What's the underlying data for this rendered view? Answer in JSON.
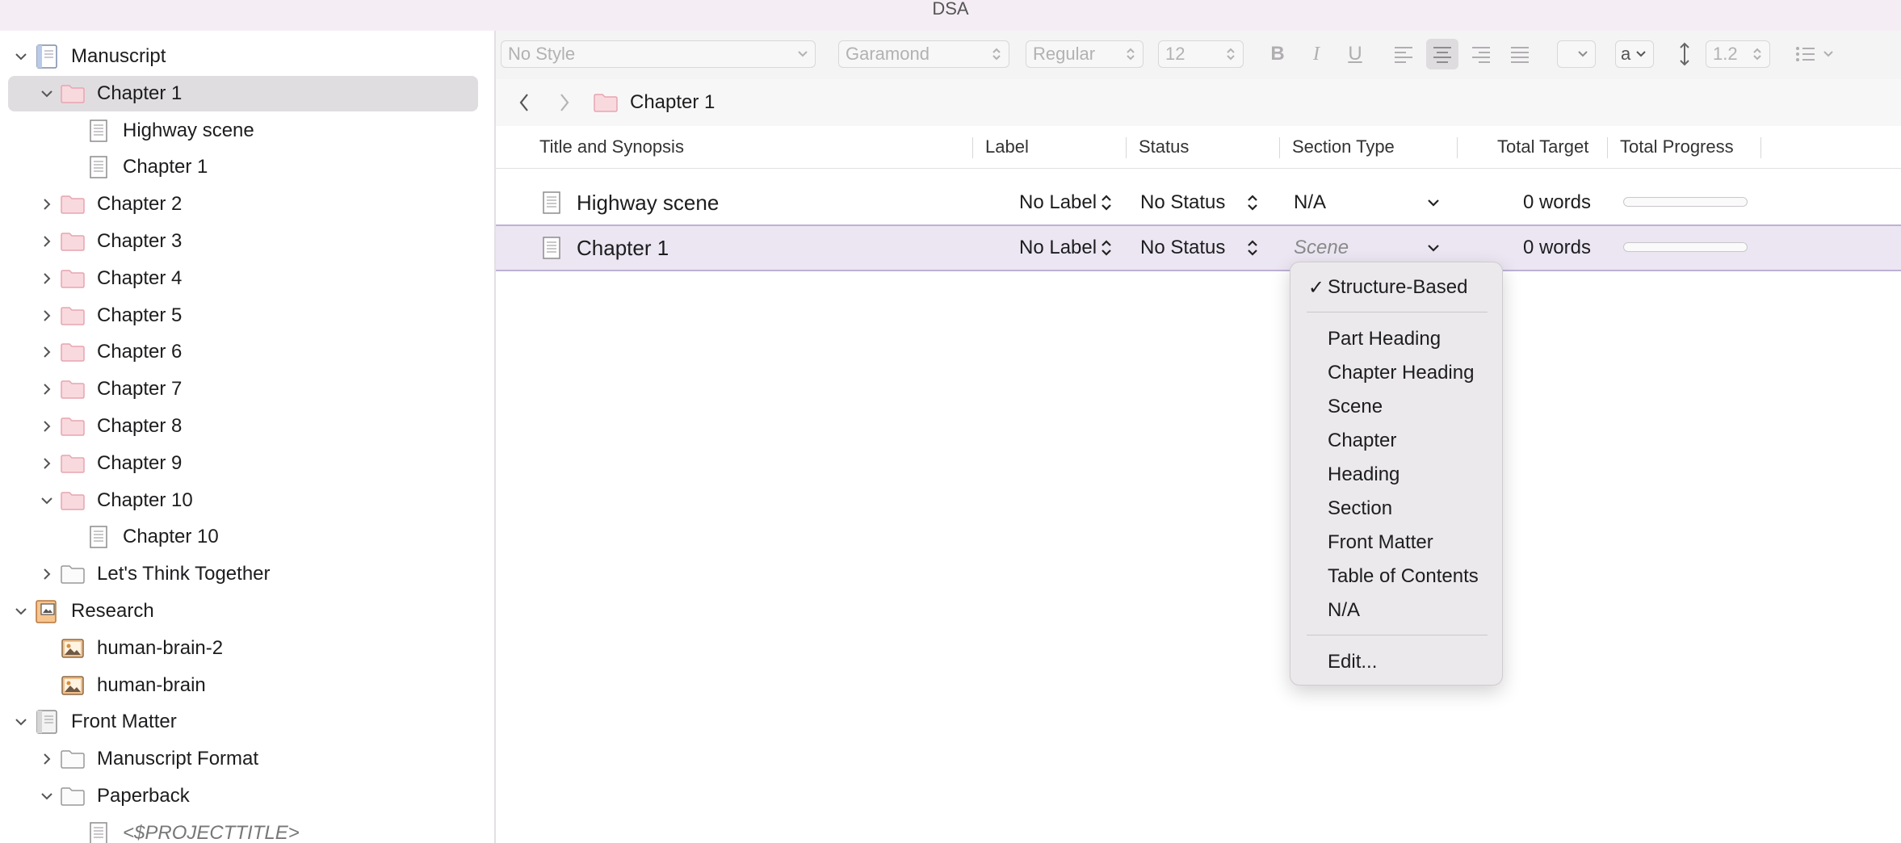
{
  "window": {
    "title": "DSA"
  },
  "binder": {
    "rows": [
      {
        "label": "Manuscript",
        "indent": 0,
        "chevron": "down",
        "icon": "manuscript",
        "selected": false,
        "italic": false
      },
      {
        "label": "Chapter 1",
        "indent": 1,
        "chevron": "down",
        "icon": "folder-pink",
        "selected": true,
        "italic": false
      },
      {
        "label": "Highway scene",
        "indent": 2,
        "chevron": "none",
        "icon": "document",
        "selected": false,
        "italic": false
      },
      {
        "label": "Chapter 1",
        "indent": 2,
        "chevron": "none",
        "icon": "document",
        "selected": false,
        "italic": false
      },
      {
        "label": "Chapter 2",
        "indent": 1,
        "chevron": "right",
        "icon": "folder-pink",
        "selected": false,
        "italic": false
      },
      {
        "label": "Chapter 3",
        "indent": 1,
        "chevron": "right",
        "icon": "folder-pink",
        "selected": false,
        "italic": false
      },
      {
        "label": "Chapter 4",
        "indent": 1,
        "chevron": "right",
        "icon": "folder-pink",
        "selected": false,
        "italic": false
      },
      {
        "label": "Chapter 5",
        "indent": 1,
        "chevron": "right",
        "icon": "folder-pink",
        "selected": false,
        "italic": false
      },
      {
        "label": "Chapter 6",
        "indent": 1,
        "chevron": "right",
        "icon": "folder-pink",
        "selected": false,
        "italic": false
      },
      {
        "label": "Chapter 7",
        "indent": 1,
        "chevron": "right",
        "icon": "folder-pink",
        "selected": false,
        "italic": false
      },
      {
        "label": "Chapter 8",
        "indent": 1,
        "chevron": "right",
        "icon": "folder-pink",
        "selected": false,
        "italic": false
      },
      {
        "label": "Chapter 9",
        "indent": 1,
        "chevron": "right",
        "icon": "folder-pink",
        "selected": false,
        "italic": false
      },
      {
        "label": "Chapter 10",
        "indent": 1,
        "chevron": "down",
        "icon": "folder-pink",
        "selected": false,
        "italic": false
      },
      {
        "label": "Chapter 10",
        "indent": 2,
        "chevron": "none",
        "icon": "document",
        "selected": false,
        "italic": false
      },
      {
        "label": "Let's Think Together",
        "indent": 1,
        "chevron": "right",
        "icon": "folder-gray",
        "selected": false,
        "italic": false
      },
      {
        "label": "Research",
        "indent": 0,
        "chevron": "down",
        "icon": "research",
        "selected": false,
        "italic": false
      },
      {
        "label": "human-brain-2",
        "indent": 1,
        "chevron": "none",
        "icon": "image",
        "selected": false,
        "italic": false
      },
      {
        "label": "human-brain",
        "indent": 1,
        "chevron": "none",
        "icon": "image",
        "selected": false,
        "italic": false
      },
      {
        "label": "Front Matter",
        "indent": 0,
        "chevron": "down",
        "icon": "front-matter",
        "selected": false,
        "italic": false
      },
      {
        "label": "Manuscript Format",
        "indent": 1,
        "chevron": "right",
        "icon": "folder-gray",
        "selected": false,
        "italic": false
      },
      {
        "label": "Paperback",
        "indent": 1,
        "chevron": "down",
        "icon": "folder-gray",
        "selected": false,
        "italic": false
      },
      {
        "label": "<$PROJECTTITLE>",
        "indent": 2,
        "chevron": "none",
        "icon": "document",
        "selected": false,
        "italic": true
      }
    ]
  },
  "format_bar": {
    "style": "No Style",
    "font": "Garamond",
    "weight": "Regular",
    "size": "12",
    "bold": "B",
    "italic": "I",
    "underline": "U",
    "highlight": "a",
    "line_spacing": "1.2"
  },
  "nav": {
    "crumb": "Chapter 1"
  },
  "outliner": {
    "headers": {
      "title": "Title and Synopsis",
      "label": "Label",
      "status": "Status",
      "section_type": "Section Type",
      "total_target": "Total Target",
      "total_progress": "Total Progress"
    },
    "rows": [
      {
        "title": "Highway scene",
        "label": "No Label",
        "status": "No Status",
        "section_type": "N/A",
        "section_italic": false,
        "target": "0 words",
        "progress": 0,
        "selected": false
      },
      {
        "title": "Chapter 1",
        "label": "No Label",
        "status": "No Status",
        "section_type": "Scene",
        "section_italic": true,
        "target": "0 words",
        "progress": 0,
        "selected": true
      }
    ]
  },
  "section_menu": {
    "checked_item": "Structure-Based",
    "items": [
      "Part Heading",
      "Chapter Heading",
      "Scene",
      "Chapter",
      "Heading",
      "Section",
      "Front Matter",
      "Table of Contents",
      "N/A"
    ],
    "edit": "Edit..."
  },
  "colors": {
    "folder_pink": "#f8d9de",
    "folder_pink_stroke": "#e7a5b0",
    "selection_row": "#ebe6f2",
    "binder_selection": "#e0dde0"
  }
}
